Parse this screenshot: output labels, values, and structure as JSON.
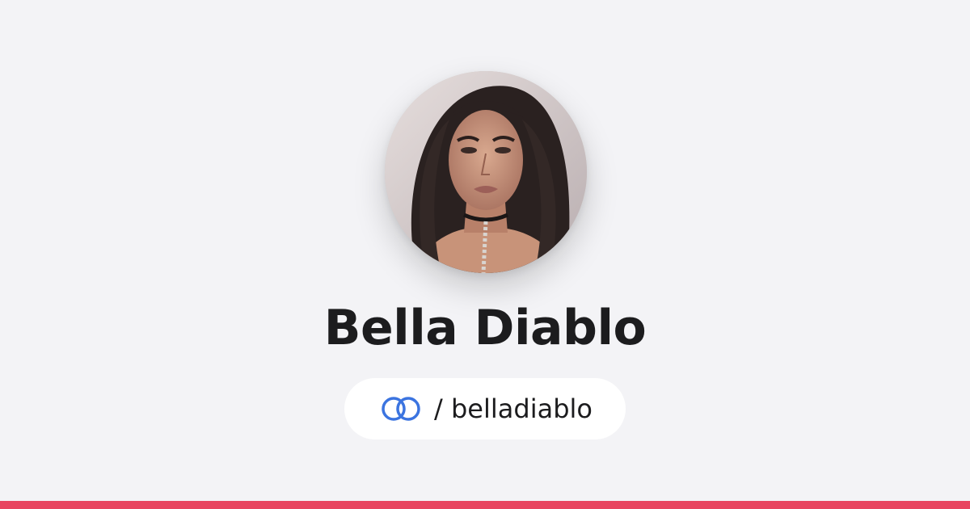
{
  "profile": {
    "name": "Bella Diablo",
    "handle": "/ belladiablo",
    "avatar_icon": "profile-photo"
  },
  "brand": {
    "logo_icon": "linked-rings-icon",
    "logo_color": "#3b74e0",
    "accent_bar_color": "#e8435f"
  }
}
